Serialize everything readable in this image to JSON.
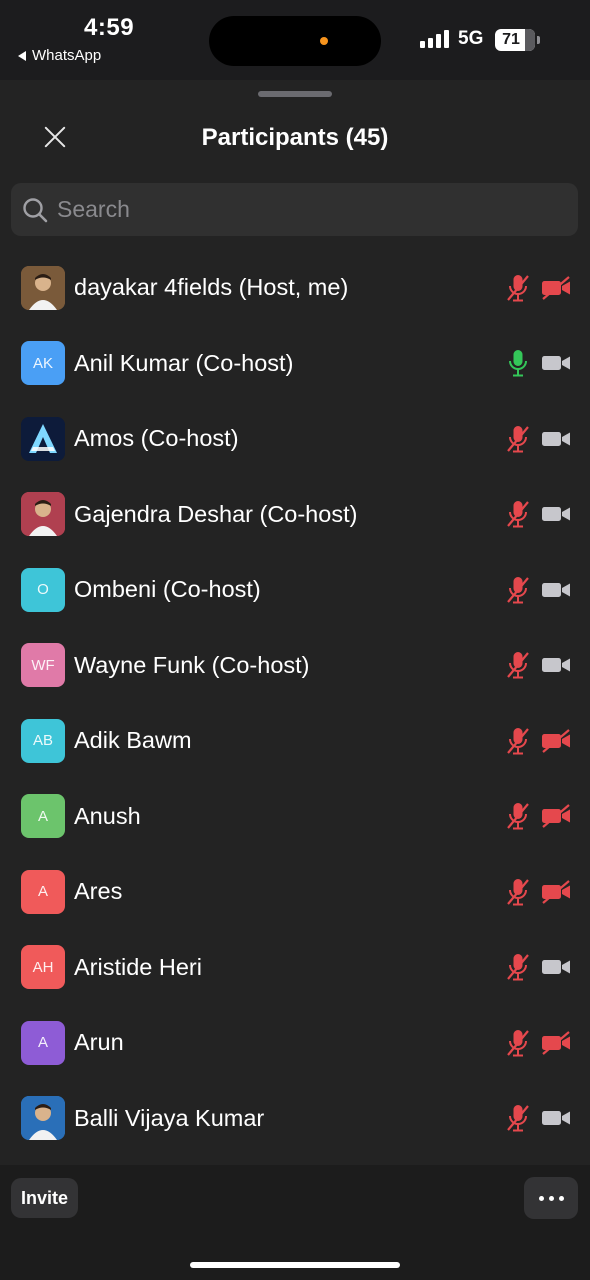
{
  "status_bar": {
    "time": "4:59",
    "back_app": "WhatsApp",
    "network": "5G",
    "battery": "71"
  },
  "header": {
    "title": "Participants (45)"
  },
  "search": {
    "placeholder": "Search"
  },
  "colors": {
    "muted_red": "#e5484d",
    "active_green": "#34c759",
    "neutral_gray": "#c7c7cc"
  },
  "participants": [
    {
      "name": "dayakar 4fields (Host, me)",
      "initials": "",
      "avatar": "photo",
      "avatar_color": "#7a5a3a",
      "mic": "muted",
      "video": "off"
    },
    {
      "name": "Anil Kumar (Co-host)",
      "initials": "AK",
      "avatar": "initials",
      "avatar_color": "#4a9ff5",
      "mic": "on",
      "video": "on"
    },
    {
      "name": "Amos (Co-host)",
      "initials": "",
      "avatar": "logo",
      "avatar_color": "#0d1b3a",
      "mic": "muted",
      "video": "on"
    },
    {
      "name": "Gajendra Deshar (Co-host)",
      "initials": "",
      "avatar": "photo",
      "avatar_color": "#b04050",
      "mic": "muted",
      "video": "on"
    },
    {
      "name": "Ombeni (Co-host)",
      "initials": "O",
      "avatar": "initials",
      "avatar_color": "#3ec5d8",
      "mic": "muted",
      "video": "on"
    },
    {
      "name": "Wayne Funk (Co-host)",
      "initials": "WF",
      "avatar": "initials",
      "avatar_color": "#e07aa8",
      "mic": "muted",
      "video": "on"
    },
    {
      "name": "Adik Bawm",
      "initials": "AB",
      "avatar": "initials",
      "avatar_color": "#3ec5d8",
      "mic": "muted",
      "video": "off"
    },
    {
      "name": "Anush",
      "initials": "A",
      "avatar": "initials",
      "avatar_color": "#6cc46c",
      "mic": "muted",
      "video": "off"
    },
    {
      "name": "Ares",
      "initials": "A",
      "avatar": "initials",
      "avatar_color": "#f05a5a",
      "mic": "muted",
      "video": "off"
    },
    {
      "name": "Aristide Heri",
      "initials": "AH",
      "avatar": "initials",
      "avatar_color": "#f05a5a",
      "mic": "muted",
      "video": "on"
    },
    {
      "name": "Arun",
      "initials": "A",
      "avatar": "initials",
      "avatar_color": "#8e5cd6",
      "mic": "muted",
      "video": "off"
    },
    {
      "name": "Balli Vijaya Kumar",
      "initials": "",
      "avatar": "photo",
      "avatar_color": "#2a6fb8",
      "mic": "muted",
      "video": "on"
    }
  ],
  "bottom_bar": {
    "invite_label": "Invite"
  }
}
